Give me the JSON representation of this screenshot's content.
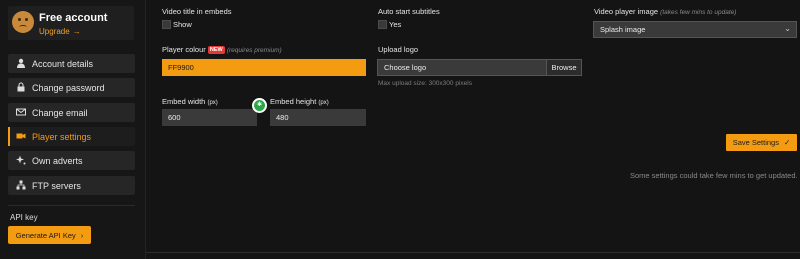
{
  "account": {
    "title": "Free account",
    "upgrade": "Upgrade",
    "upgrade_icon": "arrow-right-icon"
  },
  "sidebar": {
    "items": [
      {
        "label": "Account details",
        "icon": "user-icon"
      },
      {
        "label": "Change password",
        "icon": "lock-icon"
      },
      {
        "label": "Change email",
        "icon": "mail-icon"
      },
      {
        "label": "Player settings",
        "icon": "video-camera-icon",
        "active": true
      },
      {
        "label": "Own adverts",
        "icon": "sparkle-icon"
      },
      {
        "label": "FTP servers",
        "icon": "network-icon"
      }
    ],
    "api_label": "API key",
    "api_button": "Generate API Key"
  },
  "fields": {
    "video_title": {
      "label": "Video title in embeds",
      "option": "Show",
      "checked": false
    },
    "auto_subs": {
      "label": "Auto start subtitles",
      "option": "Yes",
      "checked": false
    },
    "video_image": {
      "label": "Video player image",
      "note": "(takes few mins to update)",
      "value": "Splash image"
    },
    "player_colour": {
      "label": "Player colour",
      "badge": "NEW",
      "note": "(requires premium)",
      "value": "FF9900"
    },
    "upload_logo": {
      "label": "Upload logo",
      "choose": "Choose logo",
      "browse": "Browse",
      "hint": "Max upload size: 300x300 pixels"
    },
    "embed_width": {
      "label": "Embed width",
      "unit": "(px)",
      "value": "600"
    },
    "embed_height": {
      "label": "Embed height",
      "unit": "(px)",
      "value": "480"
    }
  },
  "save_button": "Save Settings",
  "note": "Some settings could take few mins to get updated.",
  "colors": {
    "accent": "#f39c12",
    "bg": "#141414",
    "badge_red": "#e53935",
    "green": "#28a745"
  }
}
